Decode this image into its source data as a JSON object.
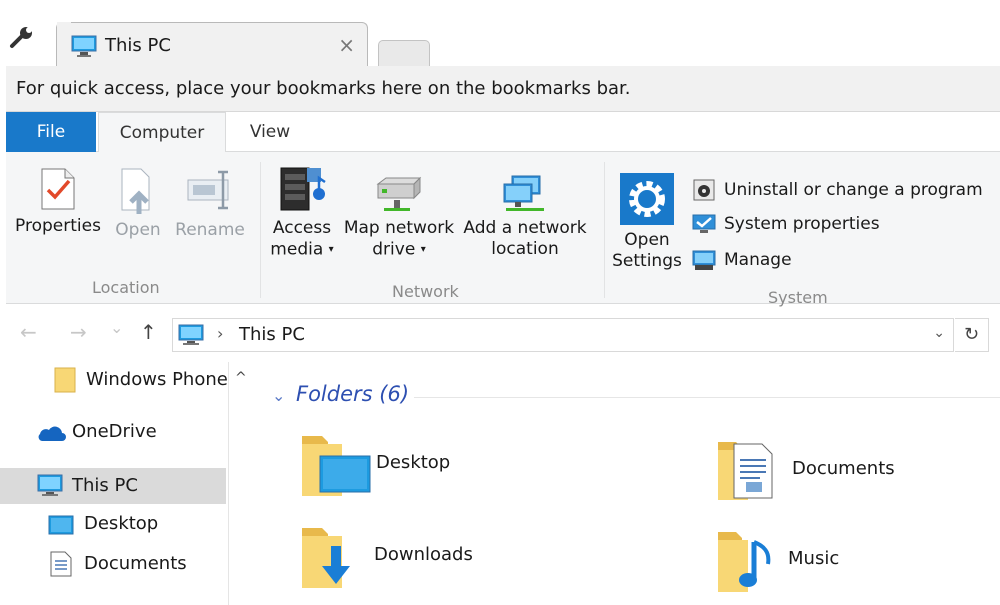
{
  "browser": {
    "tab_title": "This PC",
    "tab_close": "×",
    "bookmarks_hint": "For quick access, place your bookmarks here on the bookmarks bar."
  },
  "ribbon": {
    "tabs": {
      "file": "File",
      "computer": "Computer",
      "view": "View"
    },
    "location": {
      "label": "Location",
      "properties": "Properties",
      "open": "Open",
      "rename": "Rename"
    },
    "network": {
      "label": "Network",
      "access_media_1": "Access",
      "access_media_2": "media",
      "map_drive_1": "Map network",
      "map_drive_2": "drive",
      "add_location_1": "Add a network",
      "add_location_2": "location"
    },
    "system": {
      "label": "System",
      "open_settings_1": "Open",
      "open_settings_2": "Settings",
      "uninstall": "Uninstall or change a program",
      "system_properties": "System properties",
      "manage": "Manage"
    },
    "caret": "▾"
  },
  "address": {
    "back": "←",
    "forward": "→",
    "recent": "⌄",
    "up": "↑",
    "separator": "›",
    "crumb": "This PC",
    "dropdown": "⌄",
    "refresh": "↻"
  },
  "nav_pane": {
    "scroll_up": "^",
    "items": [
      {
        "label": "Windows Phone"
      },
      {
        "label": "OneDrive"
      },
      {
        "label": "This PC"
      },
      {
        "label": "Desktop"
      },
      {
        "label": "Documents"
      }
    ]
  },
  "content": {
    "section_chevron": "⌄",
    "section_title": "Folders (6)",
    "folders": [
      {
        "label": "Desktop"
      },
      {
        "label": "Documents"
      },
      {
        "label": "Downloads"
      },
      {
        "label": "Music"
      }
    ]
  },
  "colors": {
    "accent": "#1979ca",
    "folder_yellow": "#f8d775",
    "section_title": "#2d4fb1"
  }
}
